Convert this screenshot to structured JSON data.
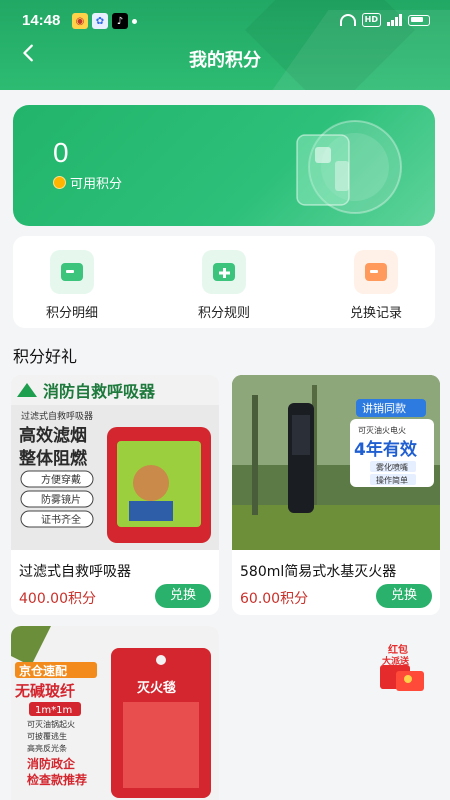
{
  "status_bar": {
    "time": "14:48",
    "network": "HD",
    "signal": "4G"
  },
  "header": {
    "title": "我的积分"
  },
  "points": {
    "value": "0",
    "label": "可用积分"
  },
  "menu": [
    {
      "label": "积分明细",
      "icon": "list-icon"
    },
    {
      "label": "积分规则",
      "icon": "plus-icon"
    },
    {
      "label": "兑换记录",
      "icon": "record-icon"
    }
  ],
  "section": {
    "title": "积分好礼"
  },
  "products": [
    {
      "name": "过滤式自救呼吸器",
      "price": "400.00积分",
      "button": "兑换",
      "image_text": {
        "banner": "消防自救呼吸器",
        "sub": "过滤式自救呼吸器",
        "line1": "高效滤烟",
        "line2": "整体阻燃",
        "tags": [
          "方便穿戴",
          "防雾镜片",
          "证书齐全"
        ]
      }
    },
    {
      "name": "580ml简易式水基灭火器",
      "price": "60.00积分",
      "button": "兑换",
      "image_text": {
        "badge_top": "讲销同款",
        "badge_sub": "可灭油火电火",
        "badge_main": "4年有效",
        "tags": [
          "雾化喷嘴",
          "操作简单"
        ]
      }
    },
    {
      "name": "",
      "price": "",
      "button": "",
      "image_text": {
        "line1": "京仓速配",
        "line2": "无碱玻纤",
        "size": "1m*1m",
        "notes": [
          "可灭油锅起火",
          "可披覆逃生",
          "高亮反光条"
        ],
        "tag1": "消防政企",
        "tag2": "检查款推荐",
        "label": "灭火毯"
      }
    }
  ],
  "float_badge": {
    "line1": "红包",
    "line2": "大派送"
  },
  "colors": {
    "primary": "#21a864",
    "price": "#c9312b",
    "button": "#2ab16b"
  }
}
